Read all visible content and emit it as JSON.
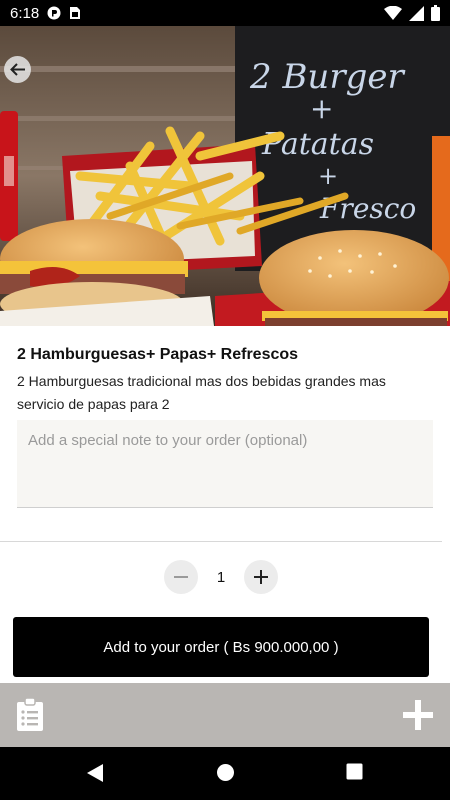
{
  "status_bar": {
    "time": "6:18",
    "icons_left": [
      "notification-app-icon",
      "sim-card-icon"
    ],
    "icons_right": [
      "wifi-icon",
      "signal-icon",
      "battery-icon"
    ]
  },
  "hero": {
    "image": "burgers-fries-soda-photo",
    "chalkboard_text": [
      "2 Burger",
      "+",
      "Patatas",
      "+",
      "Fresco"
    ]
  },
  "product": {
    "name": "2 Hamburguesas+ Papas+ Refrescos",
    "description": "2 Hamburguesas tradicional mas dos bebidas grandes mas servicio de papas para 2"
  },
  "note": {
    "placeholder": "Add a special note to your order (optional)",
    "value": ""
  },
  "quantity": {
    "value": "1",
    "decrement_icon": "minus-icon",
    "increment_icon": "plus-icon"
  },
  "add_button": {
    "label": "Add to your order ( Bs 900.000,00 )"
  },
  "bottom_bar": {
    "left_icon": "clipboard-list-icon",
    "right_icon": "plus-icon"
  },
  "nav_bar": {
    "icons": [
      "back-triangle-icon",
      "home-circle-icon",
      "recents-square-icon"
    ]
  },
  "colors": {
    "button_bg": "#000000",
    "bottom_bar_bg": "#b9b6b3",
    "note_bg": "#f7f6f3"
  }
}
